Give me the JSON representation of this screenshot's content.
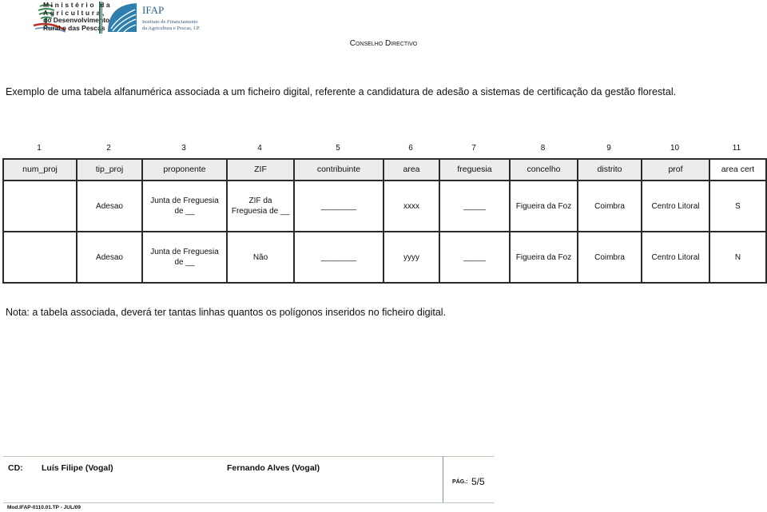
{
  "header": {
    "ministry_lines": [
      "Ministério da",
      "Agricultura,",
      "do Desenvolvimento",
      "Rural e das Pescas"
    ],
    "ifap_title": "IFAP",
    "ifap_subtitle_lines": [
      "Instituto de Financiamento",
      "da Agricultura e Pescas, I.P."
    ],
    "council": "Conselho Directivo"
  },
  "intro_text": "Exemplo de uma tabela alfanumérica associada a um ficheiro digital, referente a candidatura de adesão a sistemas de certificação da gestão florestal.",
  "table": {
    "column_numbers": [
      "1",
      "2",
      "3",
      "4",
      "5",
      "6",
      "7",
      "8",
      "9",
      "10",
      "11"
    ],
    "headers": [
      "num_proj",
      "tip_proj",
      "proponente",
      "ZIF",
      "contribuinte",
      "area",
      "freguesia",
      "concelho",
      "distrito",
      "prof",
      "area cert"
    ],
    "rows": [
      {
        "num_proj": "",
        "tip_proj": "Adesao",
        "proponente": "Junta de Freguesia de __",
        "zif": "ZIF da Freguesia de __",
        "contribuinte": "________",
        "area": "xxxx",
        "freguesia": "_____",
        "concelho": "Figueira da Foz",
        "distrito": "Coimbra",
        "prof": "Centro Litoral",
        "area_cert": "S"
      },
      {
        "num_proj": "",
        "tip_proj": "Adesao",
        "proponente": "Junta de Freguesia de __",
        "zif": "Não",
        "contribuinte": "________",
        "area": "yyyy",
        "freguesia": "_____",
        "concelho": "Figueira da Foz",
        "distrito": "Coimbra",
        "prof": "Centro Litoral",
        "area_cert": "N"
      }
    ]
  },
  "note_text": "Nota: a tabela associada, deverá ter tantas linhas quantos os polígonos inseridos no ficheiro digital.",
  "footer": {
    "cd_label": "CD:",
    "signatory_1": "Luís Filipe (Vogal)",
    "signatory_2": "Fernando Alves (Vogal)",
    "page_label": "PÁG.:",
    "page_value": "5/5",
    "model_code": "Mod.IFAP-0110.01.TP - JUL/09"
  },
  "colors": {
    "header_fill": "#ececec",
    "border": "#2a2a2a",
    "ifap_blue": "#2b5f8a",
    "ministry_green": "#2a6b55"
  }
}
